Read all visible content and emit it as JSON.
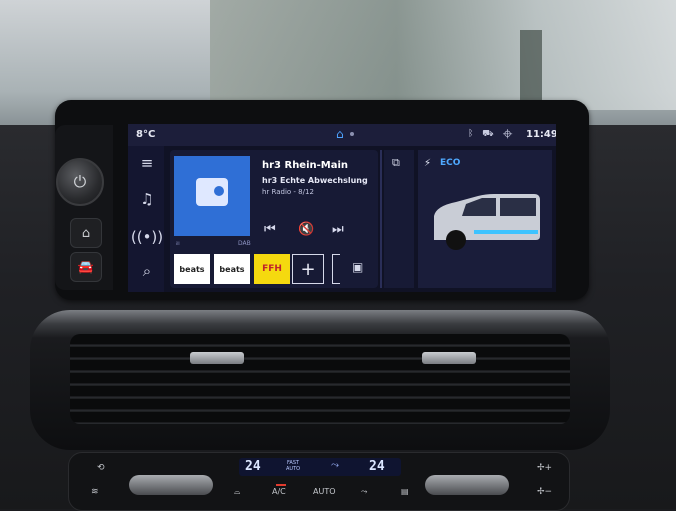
{
  "status": {
    "temperature": "8°C",
    "time": "11:49",
    "icons": [
      "bluetooth-icon",
      "connected-car-icon",
      "location-icon",
      "signal-icon"
    ]
  },
  "nav": {
    "items": [
      "menu-icon",
      "music-note-icon",
      "radio-wave-icon",
      "search-icon"
    ]
  },
  "media": {
    "station": "hr3 Rhein-Main",
    "song": "hr3 Echte Abwechslung",
    "source": "hr Radio - 8/12",
    "signal_label": "ᵢₗₗ",
    "dab_label": "DAB",
    "presets": [
      "beats",
      "beats",
      "FFH"
    ]
  },
  "eco": {
    "label": "ECO"
  },
  "climate": {
    "left_temp": "24",
    "right_temp": "24",
    "auto_top": "FAST",
    "auto_bottom": "AUTO",
    "ac_label": "A/C",
    "auto_label": "AUTO"
  },
  "colors": {
    "accent": "#4da3ff",
    "eco": "#4fa9ff",
    "album": "#2f6fd6",
    "ffh_yellow": "#f5d90f",
    "ac_led": "#e03b2e"
  }
}
